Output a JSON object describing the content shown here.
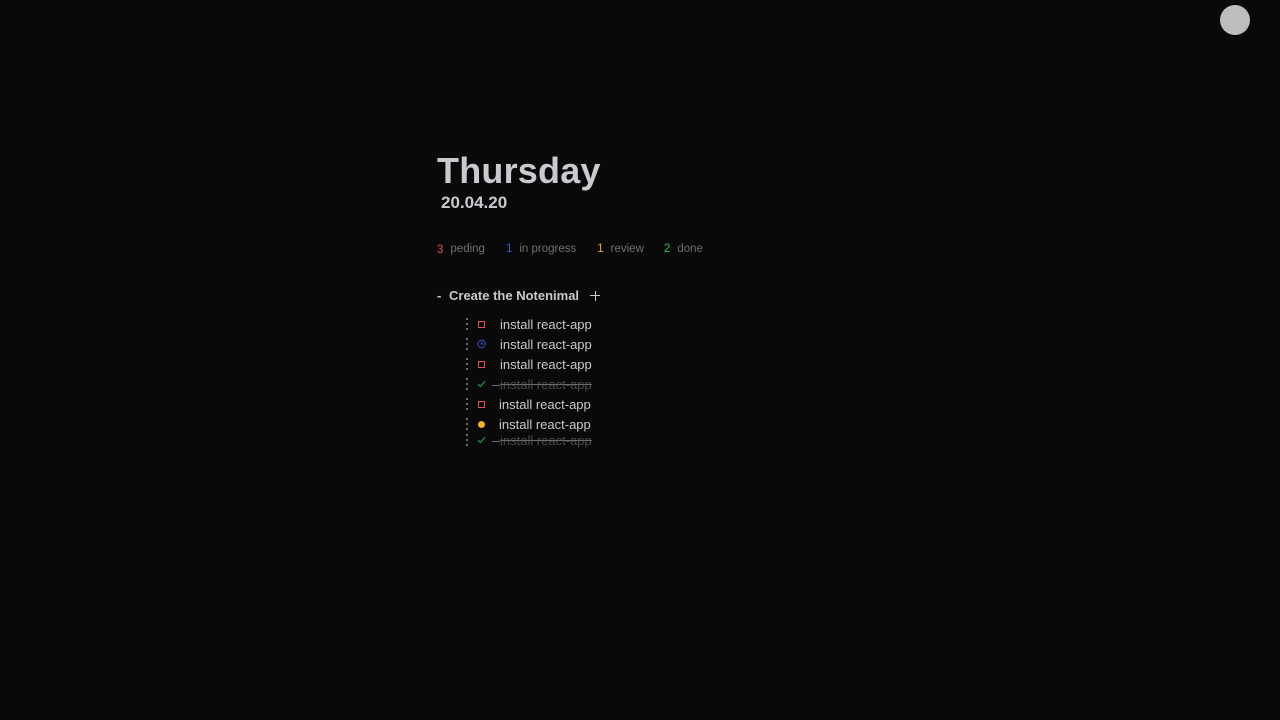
{
  "header": {
    "day": "Thursday",
    "date": "20.04.20"
  },
  "stats": {
    "pending": {
      "count": "3",
      "label": "peding",
      "color": "#e2504f"
    },
    "in_progress": {
      "count": "1",
      "label": "in progress",
      "color": "#3b56e6"
    },
    "review": {
      "count": "1",
      "label": "review",
      "color": "#f2b01e"
    },
    "done": {
      "count": "2",
      "label": "done",
      "color": "#2fbf4a"
    }
  },
  "section": {
    "collapse_label": "-",
    "title": "Create the Notenimal",
    "add_icon": "plus-icon"
  },
  "tasks": [
    {
      "text": "install react-app",
      "status": "pending"
    },
    {
      "text": "install react-app",
      "status": "in_progress"
    },
    {
      "text": "install react-app",
      "status": "pending"
    },
    {
      "text": "install react-app",
      "status": "done"
    },
    {
      "text": "install react-app",
      "status": "pending"
    },
    {
      "text": "install react-app",
      "status": "review"
    },
    {
      "text": "install react-app",
      "status": "done"
    }
  ]
}
